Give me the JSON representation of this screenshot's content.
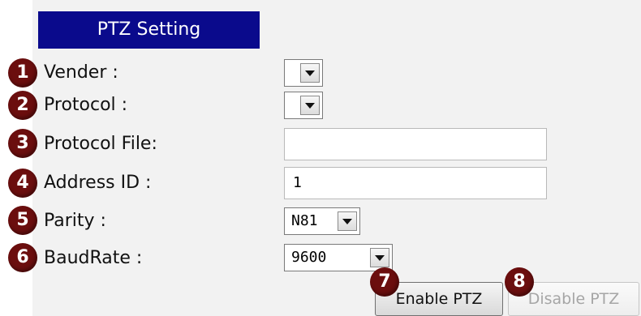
{
  "header": {
    "title": "PTZ Setting"
  },
  "fields": [
    {
      "badge": "1",
      "label": "Vender :"
    },
    {
      "badge": "2",
      "label": "Protocol :"
    },
    {
      "badge": "3",
      "label": "Protocol File:",
      "value": ""
    },
    {
      "badge": "4",
      "label": "Address ID :",
      "value": "1"
    },
    {
      "badge": "5",
      "label": "Parity :",
      "value": "N81"
    },
    {
      "badge": "6",
      "label": "BaudRate :",
      "value": "9600"
    }
  ],
  "buttons": {
    "enable": {
      "badge": "7",
      "label": "Enable PTZ"
    },
    "disable": {
      "badge": "8",
      "label": "Disable PTZ"
    }
  },
  "colors": {
    "header_bg": "#0a0a8c",
    "badge_bg": "#6b0e0e",
    "panel_bg": "#f2f2f2"
  }
}
